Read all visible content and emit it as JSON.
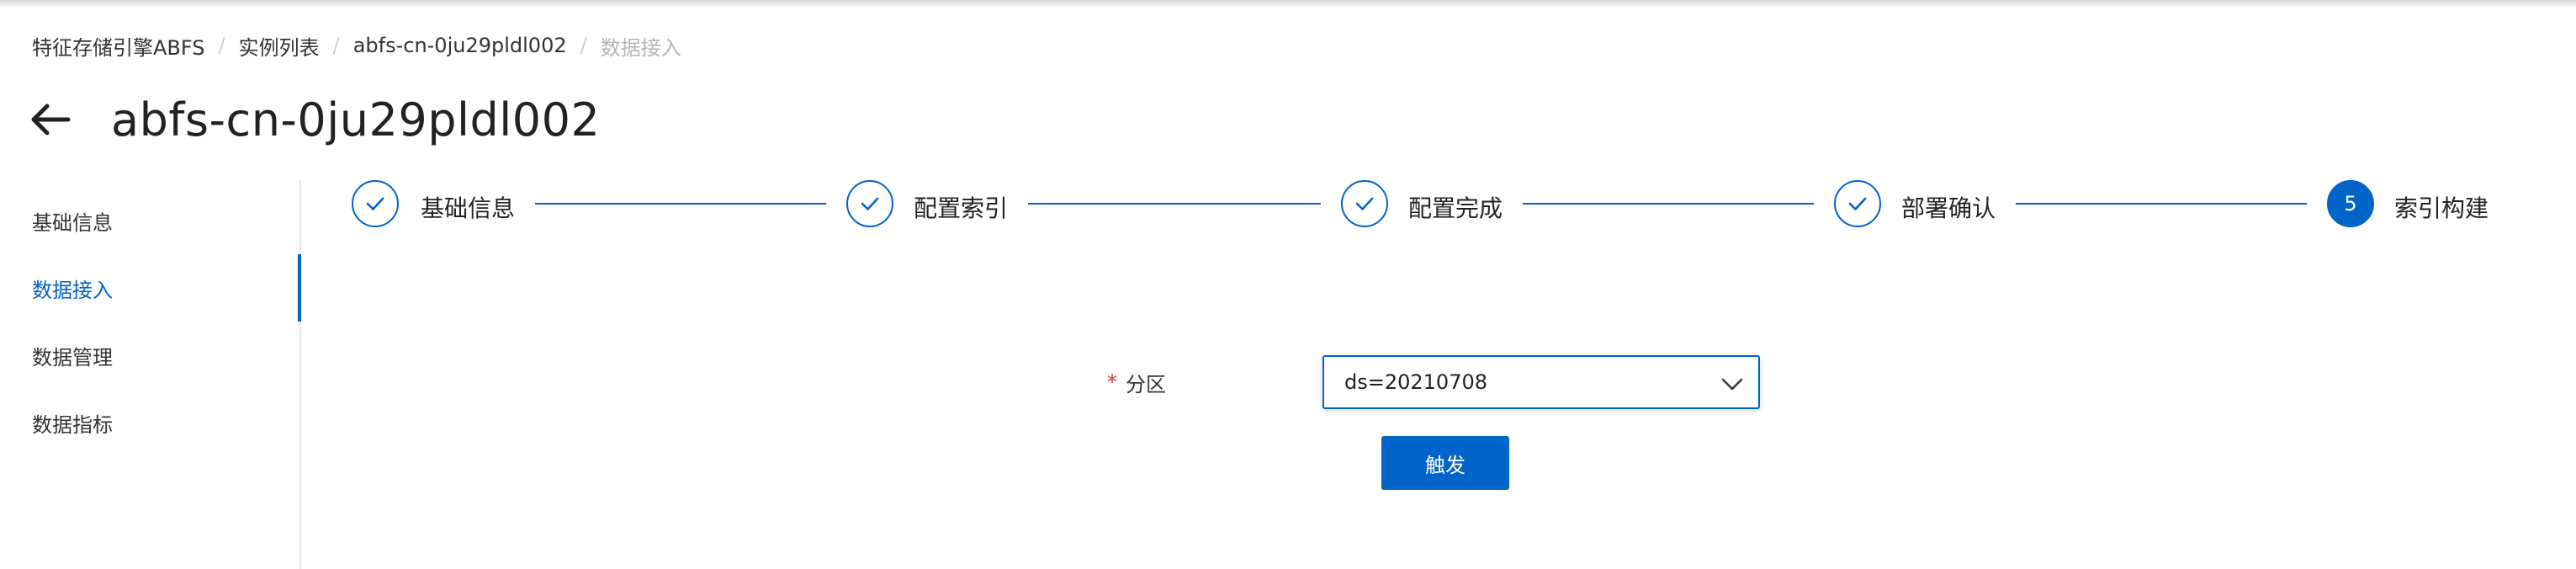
{
  "breadcrumb": {
    "items": [
      "特征存储引擎ABFS",
      "实例列表",
      "abfs-cn-0ju29pldl002",
      "数据接入"
    ],
    "separator": "/"
  },
  "header": {
    "back_icon": "arrow-left-icon",
    "title": "abfs-cn-0ju29pldl002"
  },
  "sidebar": {
    "items": [
      {
        "label": "基础信息",
        "active": false
      },
      {
        "label": "数据接入",
        "active": true
      },
      {
        "label": "数据管理",
        "active": false
      },
      {
        "label": "数据指标",
        "active": false
      }
    ]
  },
  "steps": {
    "items": [
      {
        "label": "基础信息",
        "status": "finished",
        "icon": "check-icon"
      },
      {
        "label": "配置索引",
        "status": "finished",
        "icon": "check-icon"
      },
      {
        "label": "配置完成",
        "status": "finished",
        "icon": "check-icon"
      },
      {
        "label": "部署确认",
        "status": "finished",
        "icon": "check-icon"
      },
      {
        "label": "索引构建",
        "status": "current",
        "number": "5"
      }
    ]
  },
  "form": {
    "partition": {
      "required_mark": "*",
      "label": "分区",
      "value": "ds=20210708",
      "icon": "chevron-down-icon"
    },
    "submit_label": "触发"
  },
  "colors": {
    "primary": "#0064c8",
    "required": "#d93026",
    "muted": "#b5b5b5",
    "text": "#333333"
  }
}
